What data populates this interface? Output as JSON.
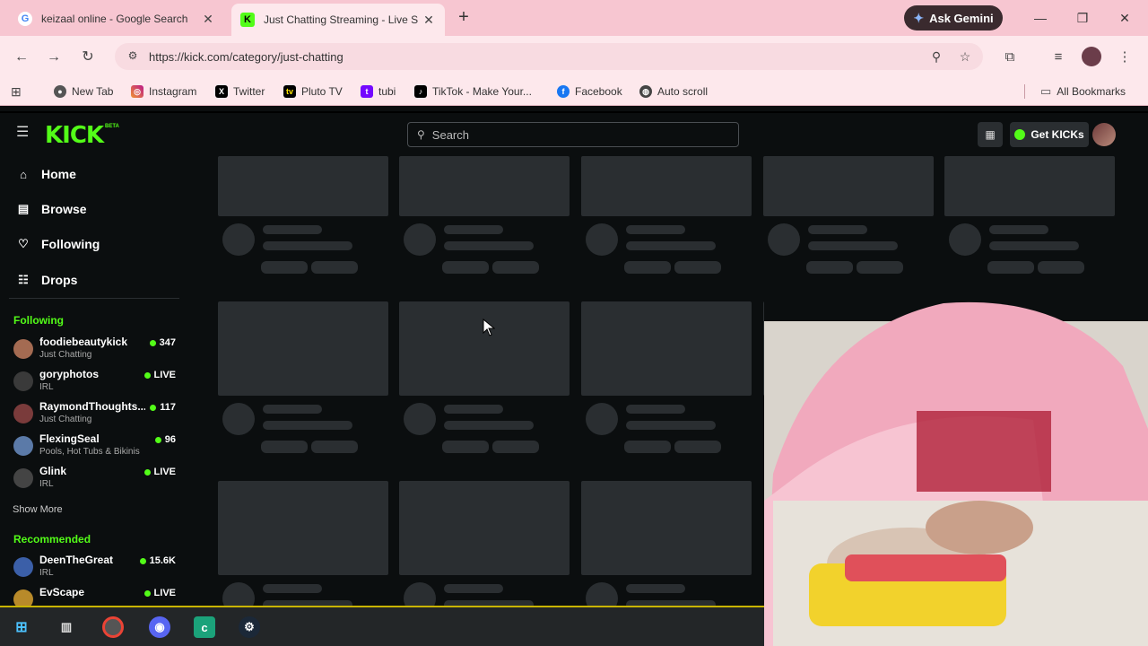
{
  "browser": {
    "tabs": [
      {
        "title": "keizaal online - Google Search",
        "favicon": "google-icon",
        "active": false
      },
      {
        "title": "Just Chatting Streaming - Live S",
        "favicon": "kick-icon",
        "active": true
      }
    ],
    "gemini_label": "Ask Gemini",
    "url": "https://kick.com/category/just-chatting",
    "bookmarks": [
      {
        "label": "New Tab",
        "icon": "chrome-icon"
      },
      {
        "label": "Instagram",
        "icon": "instagram-icon"
      },
      {
        "label": "Twitter",
        "icon": "x-icon"
      },
      {
        "label": "Pluto TV",
        "icon": "plutotv-icon"
      },
      {
        "label": "tubi",
        "icon": "tubi-icon"
      },
      {
        "label": "TikTok - Make Your...",
        "icon": "tiktok-icon"
      },
      {
        "label": "Facebook",
        "icon": "facebook-icon"
      },
      {
        "label": "Auto scroll",
        "icon": "globe-icon"
      }
    ],
    "all_bookmarks_label": "All Bookmarks"
  },
  "kick": {
    "logo": "KICK",
    "logo_badge": "BETA",
    "search_placeholder": "Search",
    "get_kicks_label": "Get KICKs",
    "nav": [
      {
        "label": "Home",
        "icon": "home-icon"
      },
      {
        "label": "Browse",
        "icon": "browse-icon"
      },
      {
        "label": "Following",
        "icon": "heart-icon"
      },
      {
        "label": "Drops",
        "icon": "drops-icon"
      }
    ],
    "following_title": "Following",
    "following": [
      {
        "name": "foodiebeautykick",
        "category": "Just Chatting",
        "viewers": "347",
        "color": "#a46b52"
      },
      {
        "name": "goryphotos",
        "category": "IRL",
        "viewers": "LIVE",
        "color": "#3a3a3a"
      },
      {
        "name": "RaymondThoughts...",
        "category": "Just Chatting",
        "viewers": "117",
        "color": "#7a3b3b"
      },
      {
        "name": "FlexingSeal",
        "category": "Pools, Hot Tubs & Bikinis",
        "viewers": "96",
        "color": "#5b7aa8"
      },
      {
        "name": "Glink",
        "category": "IRL",
        "viewers": "LIVE",
        "color": "#444"
      }
    ],
    "show_more_label": "Show More",
    "recommended_title": "Recommended",
    "recommended": [
      {
        "name": "DeenTheGreat",
        "category": "IRL",
        "viewers": "15.6K",
        "color": "#3b5fa8"
      },
      {
        "name": "EvScape",
        "category": "",
        "viewers": "LIVE",
        "color": "#b88a2a"
      }
    ],
    "accent_color": "#53fc18"
  },
  "taskbar": {
    "icons": [
      "windows-start-icon",
      "task-view-icon",
      "chrome-icon",
      "discord-icon",
      "cricut-icon",
      "steam-icon"
    ]
  }
}
